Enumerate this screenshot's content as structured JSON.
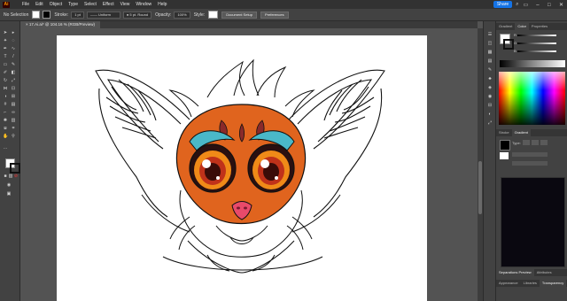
{
  "app": {
    "logo": "Ai"
  },
  "menubar": {
    "items": [
      "File",
      "Edit",
      "Object",
      "Type",
      "Select",
      "Effect",
      "View",
      "Window",
      "Help"
    ],
    "share_label": "Share"
  },
  "control_bar": {
    "selection_label": "No Selection",
    "stroke_label": "Stroke:",
    "stroke_value": "1 pt",
    "brush_value": "Uniform",
    "profile_value": "5 pt. Round",
    "opacity_label": "Opacity:",
    "opacity_value": "100%",
    "style_label": "Style:",
    "document_setup_label": "Document Setup",
    "preferences_label": "Preferences"
  },
  "document_tab": {
    "title": "17.Ai.ai* @ 104.16 % (RGB/Preview)",
    "close": "×"
  },
  "panels": {
    "top_tabs": [
      "Gradient",
      "Color",
      "Properties"
    ],
    "active_top_tab": "Color",
    "sliders": [
      "R",
      "G",
      "B"
    ],
    "stroke_tabs": [
      "Stroke",
      "Gradient"
    ],
    "gradient_type_label": "Type:",
    "bottom_tabs_1": [
      "Separations Preview",
      "Attributes"
    ],
    "bottom_tabs_2": [
      "Appearance",
      "Libraries",
      "Transparency"
    ]
  },
  "colors": {
    "accent": "#1473e6",
    "fur_orange": "#e0641e",
    "eye_amber": "#f08a18",
    "brow_blue": "#4ab8c8",
    "nose_pink": "#e84a6a"
  }
}
